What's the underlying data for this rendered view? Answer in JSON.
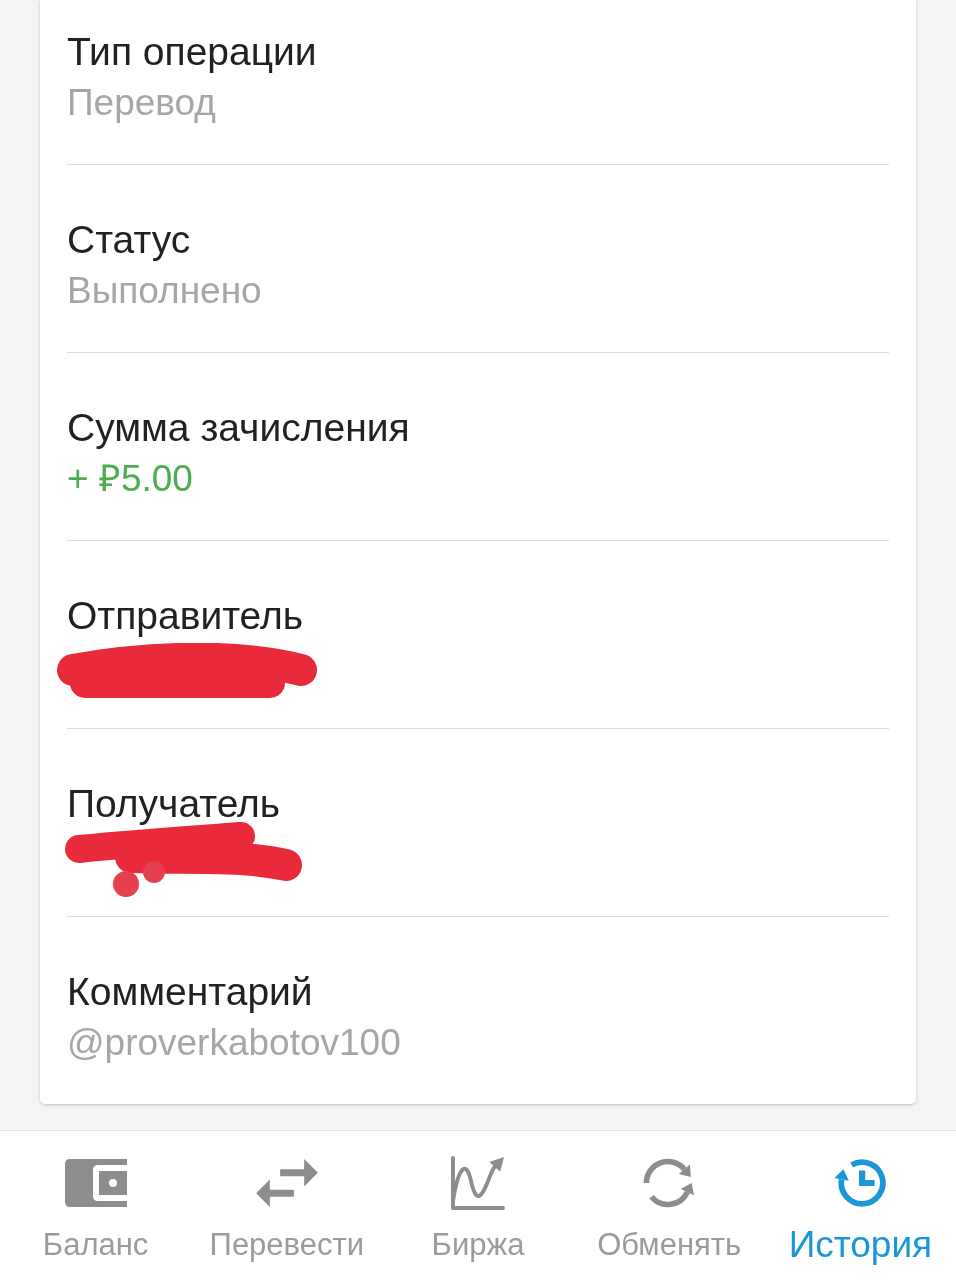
{
  "fields": [
    {
      "label": "Тип операции",
      "value": "Перевод",
      "kind": "plain"
    },
    {
      "label": "Статус",
      "value": "Выполнено",
      "kind": "plain"
    },
    {
      "label": "Сумма зачисления",
      "value": "+ ₽5.00",
      "kind": "credit"
    },
    {
      "label": "Отправитель",
      "kind": "redacted"
    },
    {
      "label": "Получатель",
      "kind": "redacted"
    },
    {
      "label": "Комментарий",
      "value": "@proverkabotov100",
      "kind": "plain"
    }
  ],
  "bottom_nav": [
    {
      "label": "Баланс",
      "selected": false
    },
    {
      "label": "Перевести",
      "selected": false
    },
    {
      "label": "Биржа",
      "selected": false
    },
    {
      "label": "Обменять",
      "selected": false
    },
    {
      "label": "История",
      "selected": true
    }
  ]
}
